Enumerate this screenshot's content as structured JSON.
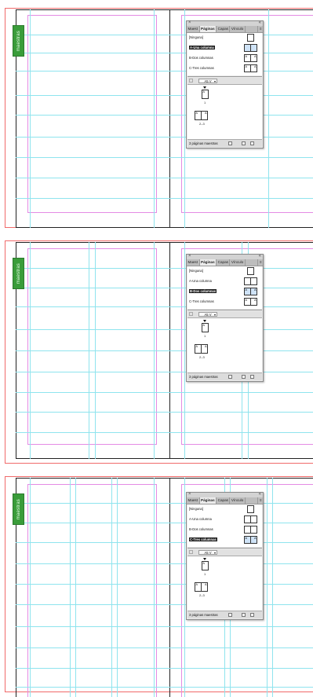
{
  "window": {
    "layer_tag": "maestras"
  },
  "panel": {
    "close_glyph": "×",
    "collapse_glyph": "«",
    "tabs": [
      "Maest",
      "Páginas",
      "Capas",
      "Vínculo"
    ],
    "menu_glyph": "≡",
    "masters": [
      {
        "label": "[Ninguna]",
        "thumb_left": "",
        "thumb_right": ""
      },
      {
        "label": "A-Una columna",
        "thumb_left": "",
        "thumb_right": ""
      },
      {
        "label": "B-Dos columnas",
        "thumb_left": "A",
        "thumb_right": "A"
      },
      {
        "label": "C-Tres columnas",
        "thumb_left": "A",
        "thumb_right": "A"
      }
    ],
    "dropdown_value": "A5 V",
    "dropdown_caret": "▾",
    "page_single": {
      "letter": "A",
      "number": "1"
    },
    "page_spread": {
      "letter_left": "A",
      "letter_right": "A",
      "number": "2–3"
    },
    "status_text": "3 páginas maestras"
  },
  "frames": [
    {
      "selected_master": "A-Una columna"
    },
    {
      "selected_master": "B-Dos columnas"
    },
    {
      "selected_master": "C-Tres columnas"
    }
  ],
  "colors": {
    "bleed": "#f06a6a",
    "margin": "#e48be4",
    "column_guide": "#8fe4ee",
    "layer_tag": "#3a9c3a",
    "selected_master_bg": "#1b1b1b"
  }
}
